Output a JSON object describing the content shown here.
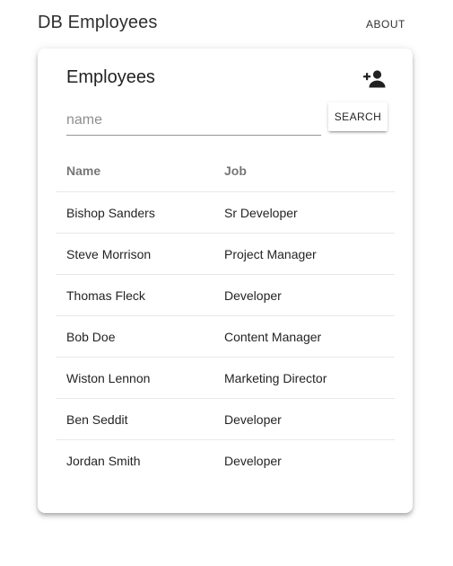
{
  "app": {
    "title": "DB Employees",
    "nav_about": "ABOUT"
  },
  "card": {
    "title": "Employees",
    "add_icon": "person-add-icon",
    "search": {
      "placeholder": "name",
      "value": "",
      "button_label": "SEARCH"
    },
    "table": {
      "columns": [
        "Name",
        "Job"
      ],
      "rows": [
        {
          "name": "Bishop Sanders",
          "job": "Sr Developer"
        },
        {
          "name": "Steve Morrison",
          "job": "Project Manager"
        },
        {
          "name": "Thomas Fleck",
          "job": "Developer"
        },
        {
          "name": "Bob Doe",
          "job": "Content Manager"
        },
        {
          "name": "Wiston Lennon",
          "job": "Marketing Director"
        },
        {
          "name": "Ben Seddit",
          "job": "Developer"
        },
        {
          "name": "Jordan Smith",
          "job": "Developer"
        }
      ]
    }
  },
  "colors": {
    "text_primary": "#212121",
    "text_secondary": "#757575",
    "background": "#ffffff"
  }
}
